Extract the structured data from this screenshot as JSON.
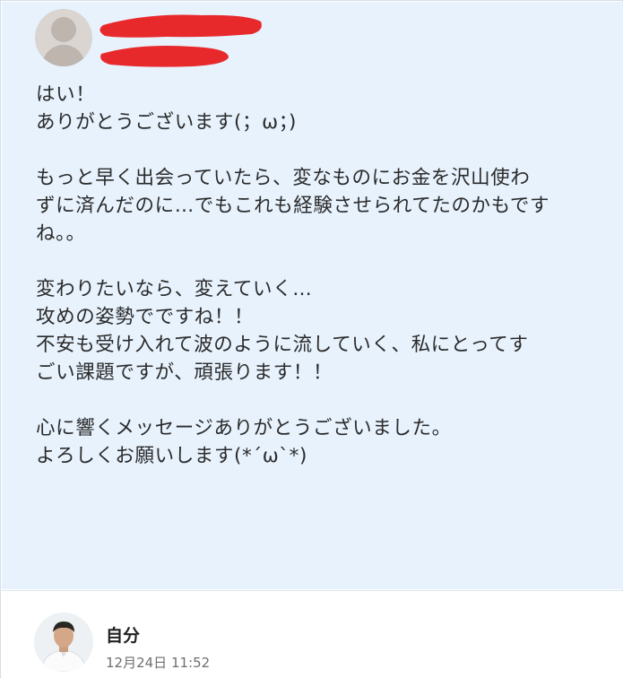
{
  "message": {
    "sender_avatar_icon": "default-user-avatar-icon",
    "sender_name_redacted": true,
    "lines": [
      "はい！",
      "ありがとうございます(；ω；)",
      "",
      "もっと早く出会っていたら、変なものにお金を沢山使わ",
      "ずに済んだのに…でもこれも経験させられてたのかもです",
      "ね。。",
      "",
      "変わりたいなら、変えていく…",
      "攻めの姿勢でですね！！",
      "不安も受け入れて波のように流していく、私にとってす",
      "ごい課題ですが、頑張ります！！",
      "",
      "心に響くメッセージありがとうございました。",
      "よろしくお願いします(*´ω`*)"
    ],
    "background_color": "#e7f2fd",
    "redaction_color": "#e8292c"
  },
  "reply": {
    "avatar_icon": "user-photo-avatar",
    "name": "自分",
    "date": "12月24日 11:52"
  }
}
